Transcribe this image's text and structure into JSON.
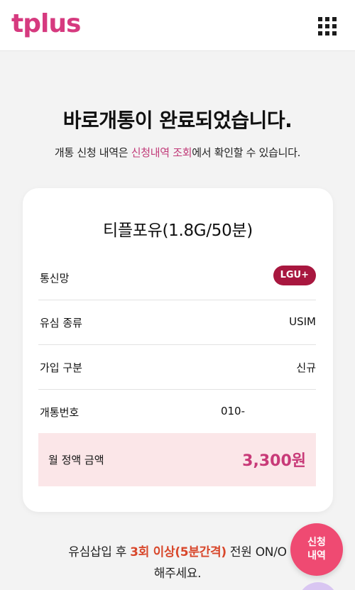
{
  "header": {
    "logo_text": "tplus",
    "menu_icon": "grid-menu-icon"
  },
  "main": {
    "title": "바로개통이 완료되었습니다.",
    "subtitle_prefix": "개통 신청 내역은 ",
    "subtitle_link": "신청내역 조회",
    "subtitle_suffix": "에서 확인할 수 있습니다."
  },
  "card": {
    "plan_name": "티플포유(1.8G/50분)",
    "rows": [
      {
        "label": "통신망",
        "value": "LGU+"
      },
      {
        "label": "유심 종류",
        "value": "USIM"
      },
      {
        "label": "가입 구분",
        "value": "신규"
      },
      {
        "label": "개통번호",
        "value": "010-"
      }
    ],
    "fee": {
      "label": "월 정액 금액",
      "value": "3,300원"
    }
  },
  "notice": {
    "part1": "유심삽입 후 ",
    "emphasis": "3회 이상(5분간격)",
    "part2": " 전원 ON/O",
    "line2": "해주세요."
  },
  "fab": {
    "line1": "신청",
    "line2": "내역"
  },
  "colors": {
    "brand": "#d63a7f",
    "badge": "#a8173f",
    "fee_bg": "#fbe6e8",
    "emphasis": "#d8472b",
    "fab": "#ef4a72"
  }
}
